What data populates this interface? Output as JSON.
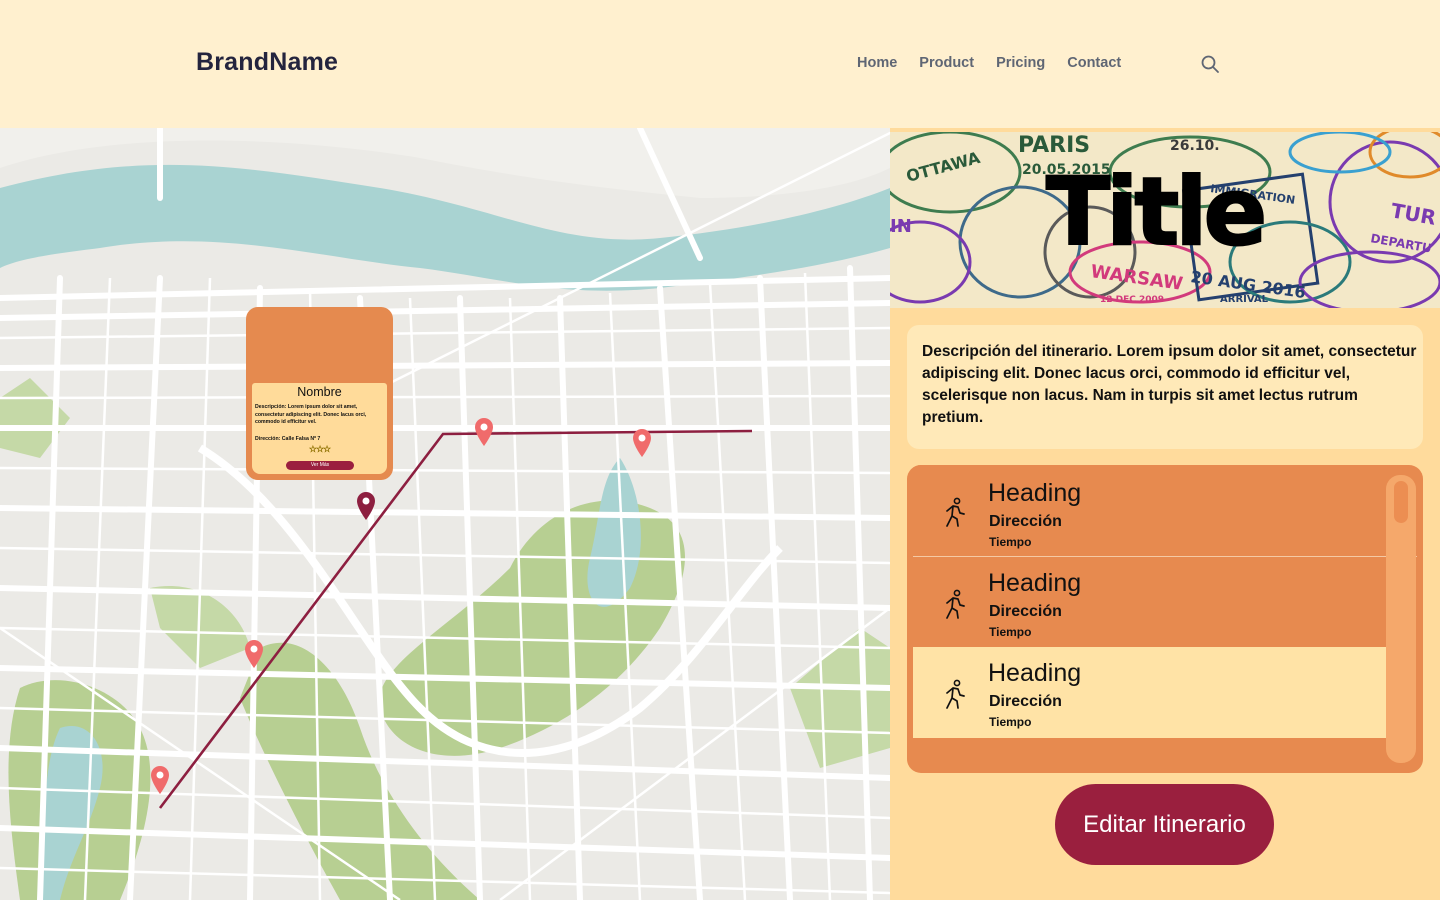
{
  "header": {
    "brand": "BrandName",
    "nav": [
      "Home",
      "Product",
      "Pricing",
      "Contact"
    ]
  },
  "popup": {
    "name": "Nombre",
    "description": "Descripción: Lorem ipsum dolor sit amet, consectetur adipiscing elit. Donec lacus orci, commodo id efficitur vel.",
    "address": "Dirección: Calle Falsa Nº 7",
    "stars": "☆☆☆",
    "button": "Ver Más"
  },
  "hero": {
    "title": "Title"
  },
  "description": "Descripción del itinerario. Lorem ipsum dolor sit amet, consectetur adipiscing elit. Donec lacus orci, commodo id efficitur vel, scelerisque non lacus. Nam in turpis sit amet lectus rutrum pretium.",
  "itinerary": [
    {
      "heading": "Heading",
      "direction": "Dirección",
      "time": "Tiempo"
    },
    {
      "heading": "Heading",
      "direction": "Dirección",
      "time": "Tiempo"
    },
    {
      "heading": "Heading",
      "direction": "Dirección",
      "time": "Tiempo"
    }
  ],
  "edit_button": "Editar Itinerario",
  "colors": {
    "header_bg": "#fff0cf",
    "panel_bg": "#ffdb9c",
    "orange": "#e78a4f",
    "crimson": "#9a1f3e",
    "pin": "#f06b6b"
  },
  "icons": [
    "search-icon",
    "walking-person-icon",
    "map-pin-icon"
  ]
}
